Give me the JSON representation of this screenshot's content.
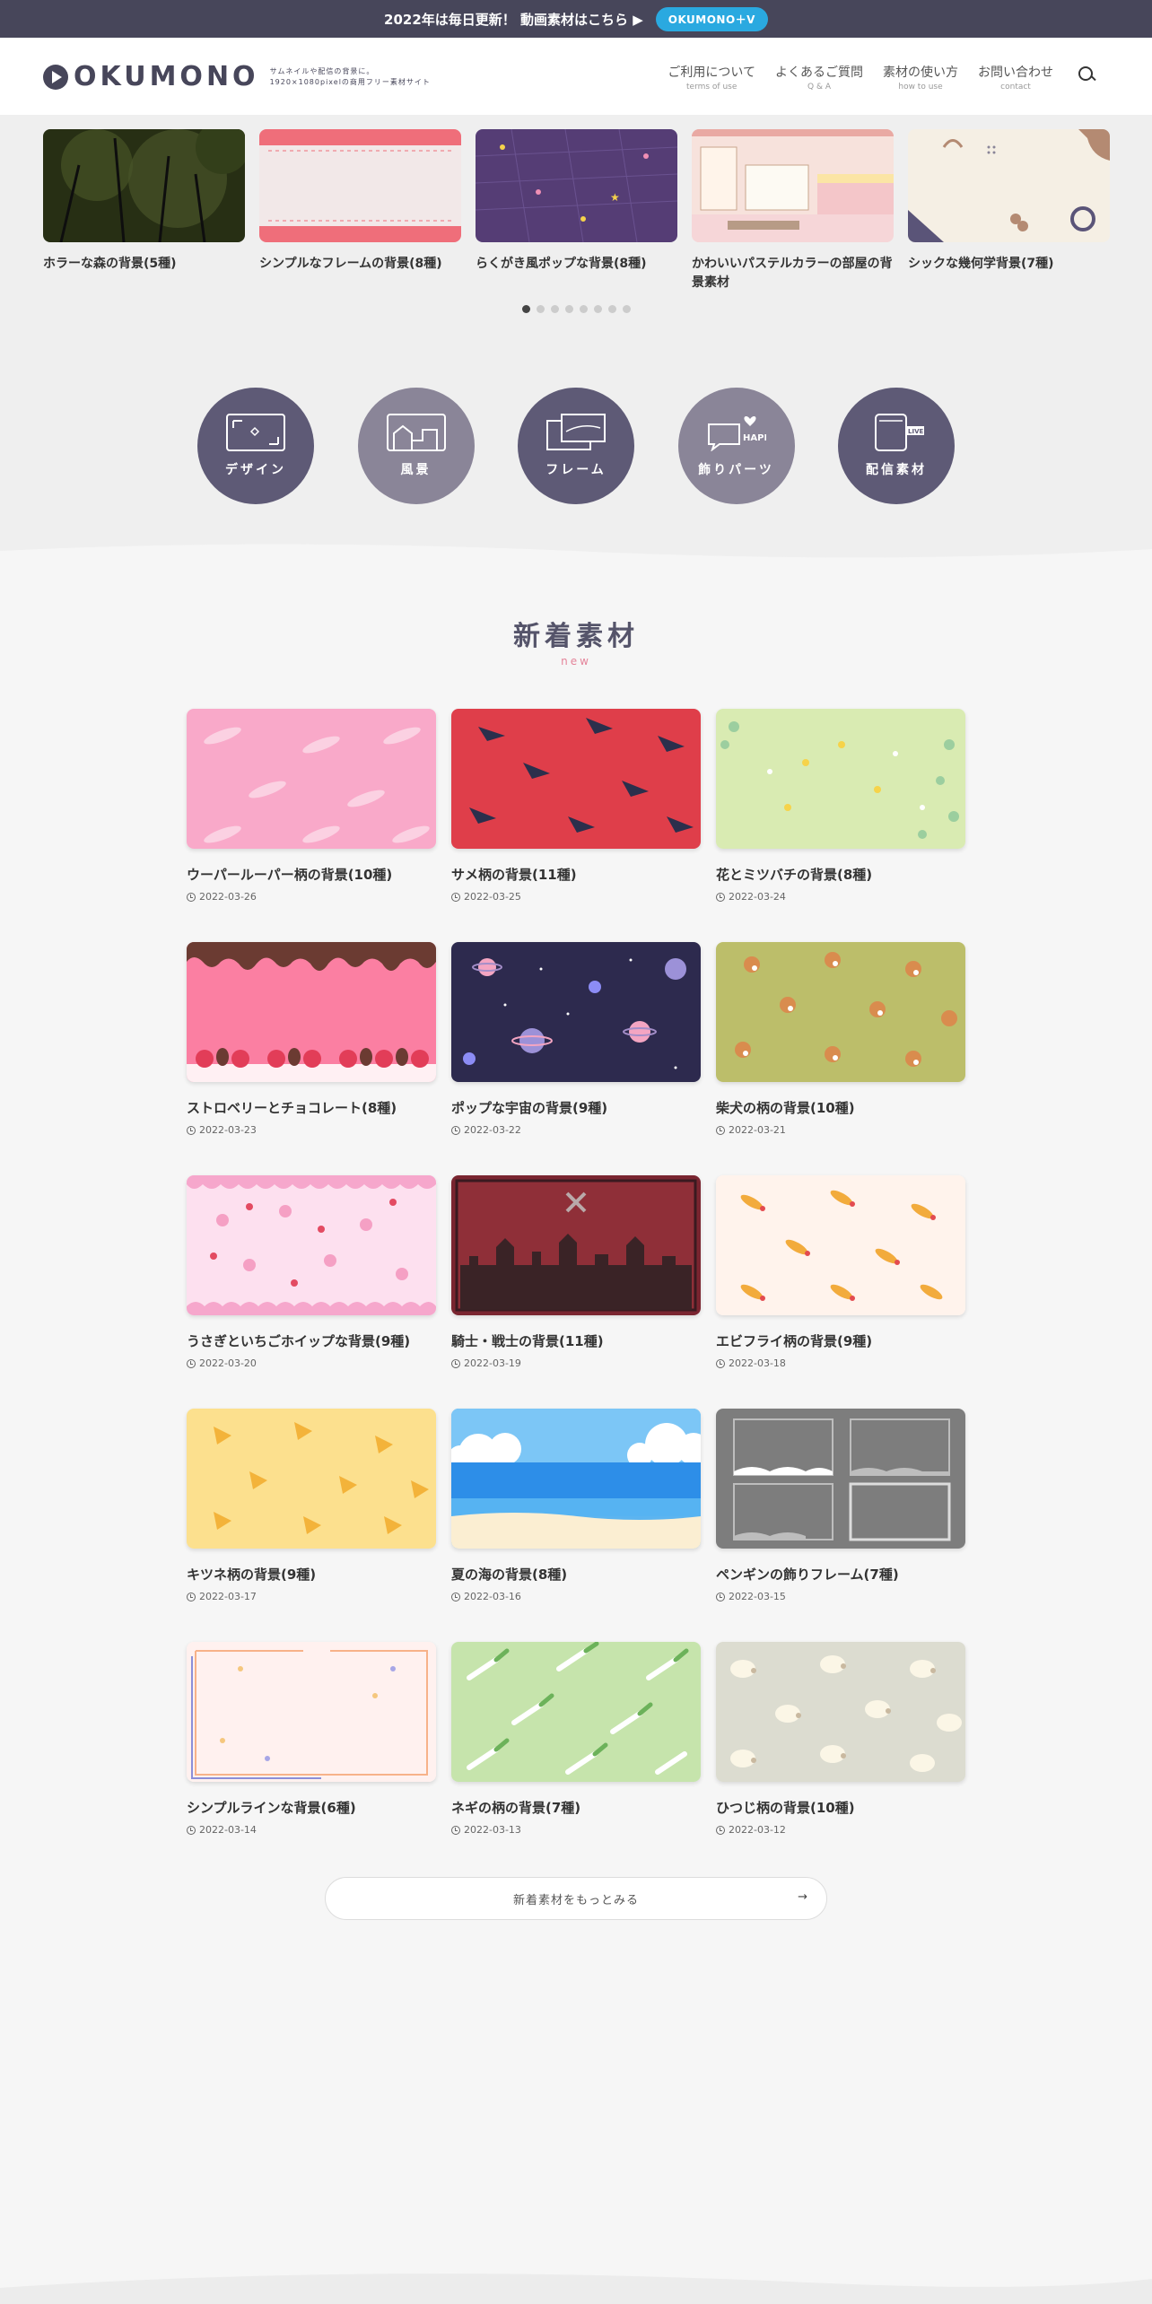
{
  "topbar": {
    "message": "2022年は毎日更新！ 動画素材はこちら ▶",
    "pill": "OKUMONO＋V"
  },
  "header": {
    "logo_text": "OKUMONO",
    "tagline_1": "サムネイルや配信の背景に。",
    "tagline_2": "1920×1080pixelの商用フリー素材サイト",
    "nav": [
      {
        "jp": "ご利用について",
        "en": "terms of use"
      },
      {
        "jp": "よくあるご質問",
        "en": "Q & A"
      },
      {
        "jp": "素材の使い方",
        "en": "how to use"
      },
      {
        "jp": "お問い合わせ",
        "en": "contact"
      }
    ]
  },
  "carousel": [
    {
      "caption": "ホラーな森の背景(5種)"
    },
    {
      "caption": "シンプルなフレームの背景(8種)"
    },
    {
      "caption": "らくがき風ポップな背景(8種)"
    },
    {
      "caption": "かわいいパステルカラーの部屋の背景素材"
    },
    {
      "caption": "シックな幾何学背景(7種)"
    }
  ],
  "carousel_dots": 8,
  "categories": [
    {
      "label": "デザイン",
      "color": "#5e5a76"
    },
    {
      "label": "風景",
      "color": "#8a8598"
    },
    {
      "label": "フレーム",
      "color": "#5e5a76"
    },
    {
      "label": "飾りパーツ",
      "color": "#8a8598"
    },
    {
      "label": "配信素材",
      "color": "#5e5a76"
    }
  ],
  "new_section": {
    "title": "新着素材",
    "subtitle": "new"
  },
  "items": [
    {
      "title": "ウーパールーパー柄の背景(10種)",
      "date": "2022-03-26"
    },
    {
      "title": "サメ柄の背景(11種)",
      "date": "2022-03-25"
    },
    {
      "title": "花とミツバチの背景(8種)",
      "date": "2022-03-24"
    },
    {
      "title": "ストロベリーとチョコレート(8種)",
      "date": "2022-03-23"
    },
    {
      "title": "ポップな宇宙の背景(9種)",
      "date": "2022-03-22"
    },
    {
      "title": "柴犬の柄の背景(10種)",
      "date": "2022-03-21"
    },
    {
      "title": "うさぎといちごホイップな背景(9種)",
      "date": "2022-03-20"
    },
    {
      "title": "騎士・戦士の背景(11種)",
      "date": "2022-03-19"
    },
    {
      "title": "エビフライ柄の背景(9種)",
      "date": "2022-03-18"
    },
    {
      "title": "キツネ柄の背景(9種)",
      "date": "2022-03-17"
    },
    {
      "title": "夏の海の背景(8種)",
      "date": "2022-03-16"
    },
    {
      "title": "ペンギンの飾りフレーム(7種)",
      "date": "2022-03-15"
    },
    {
      "title": "シンプルラインな背景(6種)",
      "date": "2022-03-14"
    },
    {
      "title": "ネギの柄の背景(7種)",
      "date": "2022-03-13"
    },
    {
      "title": "ひつじ柄の背景(10種)",
      "date": "2022-03-12"
    }
  ],
  "more_button": {
    "label": "新着素材をもっとみる",
    "arrow": "→"
  }
}
